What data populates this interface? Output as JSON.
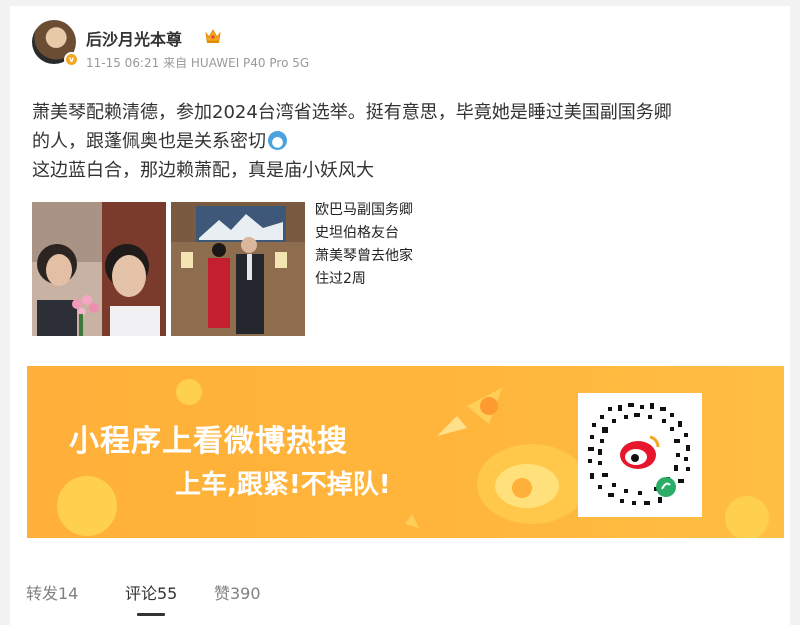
{
  "post": {
    "author": "后沙月光本尊",
    "meta": "11-15 06:21 来自 HUAWEI P40 Pro 5G",
    "text_lines": [
      "萧美琴配赖清德，参加2024台湾省选举。挺有意思，毕竟她是睡过美国副国务卿",
      "的人，跟蓬佩奥也是关系密切",
      "这边蓝白合，那边赖萧配，真是庙小妖风大"
    ],
    "image_caption_lines": [
      "欧巴马副国务卿",
      "史坦伯格友台",
      "萧美琴曾去他家",
      "住过2周"
    ]
  },
  "banner": {
    "title": "小程序上看微博热搜",
    "subtitle": "上车,跟紧!不掉队!"
  },
  "footer": {
    "repost": "转发14",
    "comments": "评论55",
    "likes": "赞390"
  },
  "icons": [
    "verified-badge-icon",
    "crown-icon",
    "doraemon-emoji-icon",
    "weibo-logo-icon",
    "wechat-miniprogram-icon"
  ],
  "colors": {
    "banner_orange": "#ffb03a",
    "text_primary": "#333333",
    "text_meta": "#999999"
  }
}
